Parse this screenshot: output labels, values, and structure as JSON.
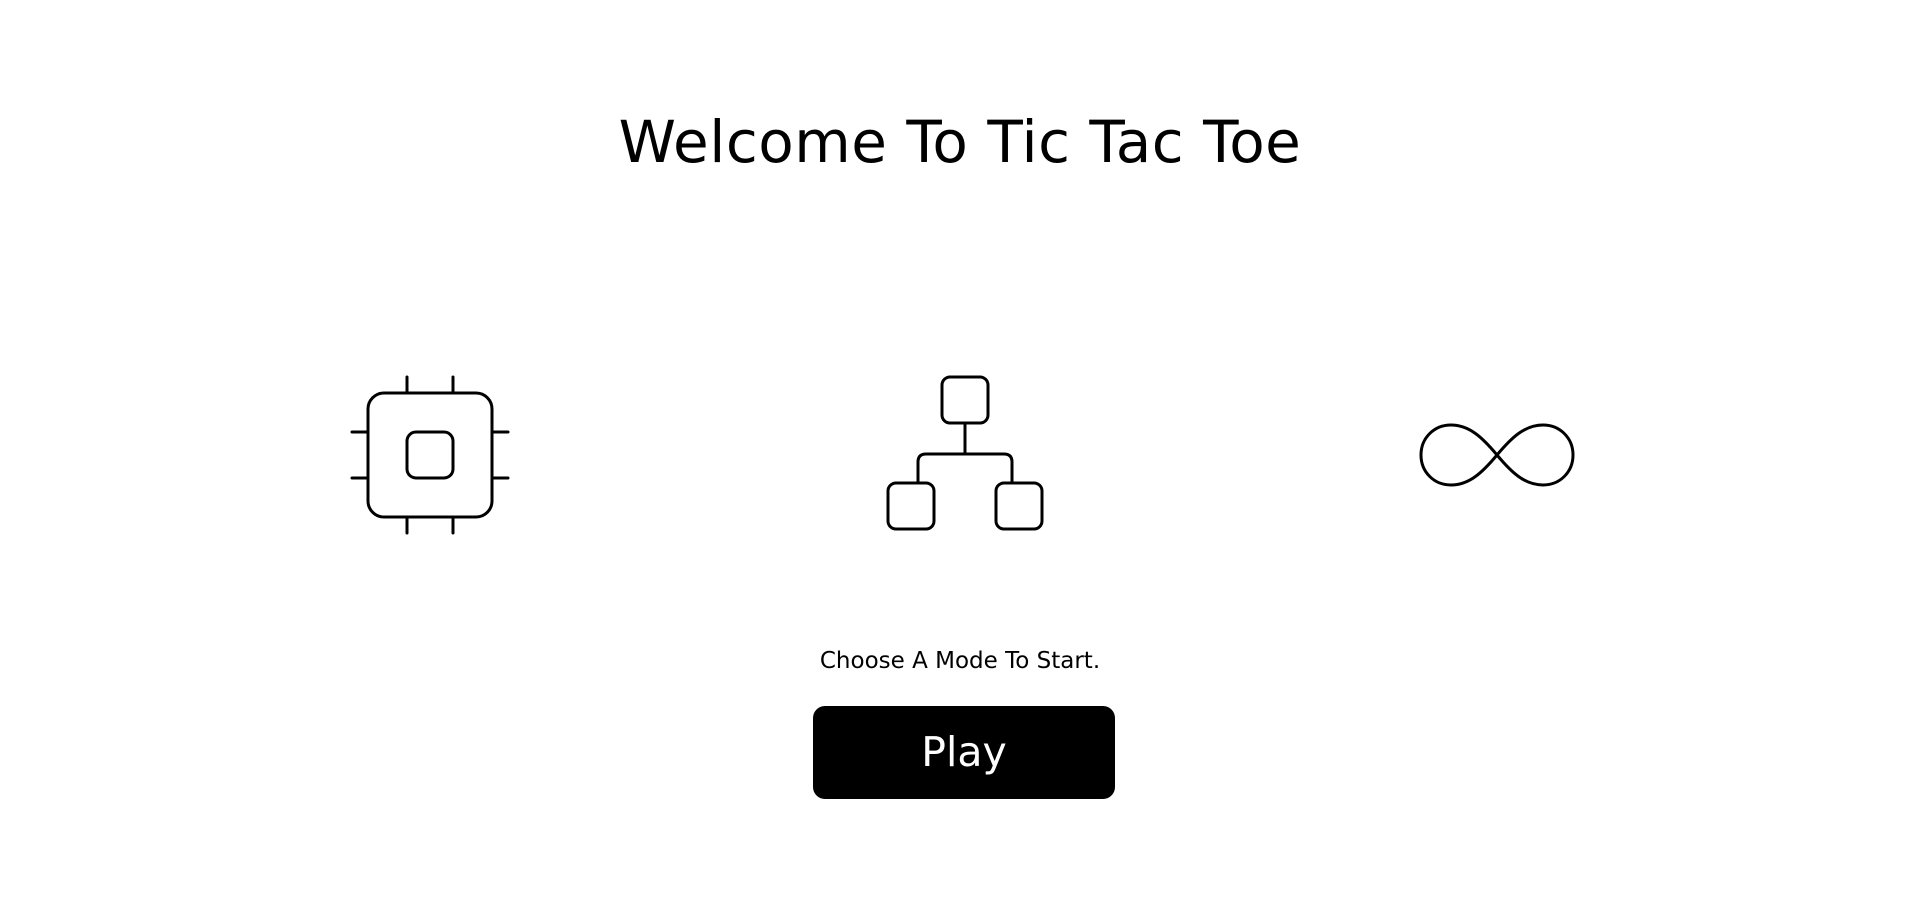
{
  "title": "Welcome To Tic Tac Toe",
  "modes": [
    {
      "icon": "cpu-chip-icon"
    },
    {
      "icon": "hierarchy-network-icon"
    },
    {
      "icon": "infinity-icon"
    }
  ],
  "hint": "Choose A Mode To Start.",
  "play_button": {
    "label": "Play",
    "background": "#000000",
    "color": "#ffffff"
  }
}
